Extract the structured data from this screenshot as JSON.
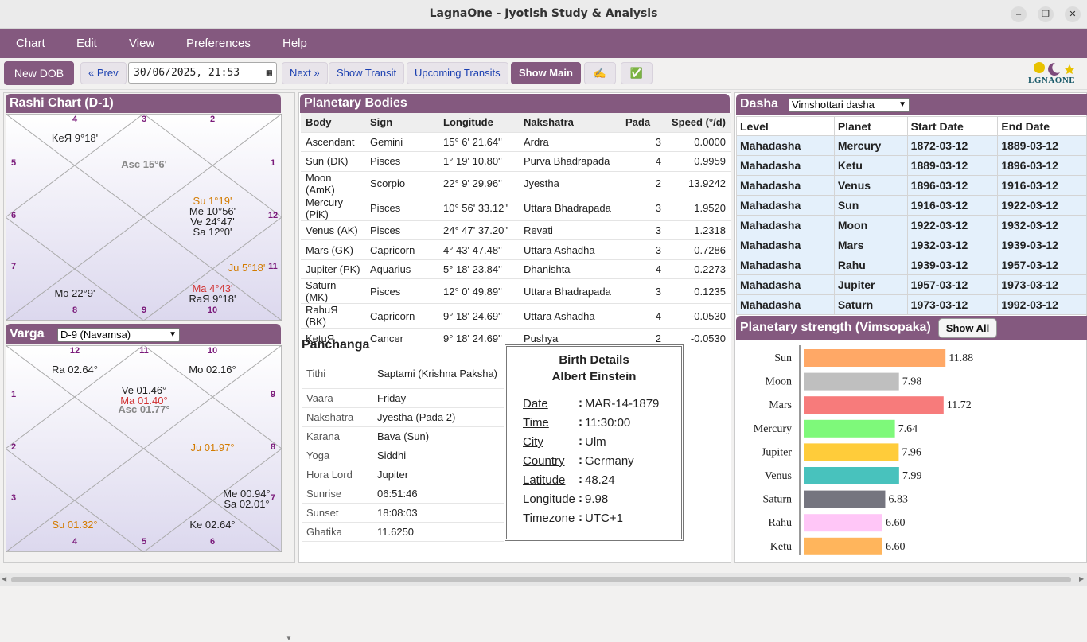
{
  "window": {
    "title": "LagnaOne - Jyotish Study & Analysis"
  },
  "menu": [
    "Chart",
    "Edit",
    "View",
    "Preferences",
    "Help"
  ],
  "toolbar": {
    "new_dob": "New DOB",
    "prev": "« Prev",
    "datetime": "30/06/2025, 21:53",
    "next": "Next »",
    "show_transit": "Show Transit",
    "upcoming_transits": "Upcoming Transits",
    "show_main": "Show Main",
    "write_icon": "✍",
    "check_icon": "✅",
    "logo_text": "LGNAONE"
  },
  "rashi": {
    "title": "Rashi Chart (D-1)",
    "signs": [
      "4",
      "3",
      "2",
      "5",
      "1",
      "6",
      "12",
      "7",
      "11",
      "8",
      "9",
      "10"
    ],
    "planets": {
      "top_left": "KeЯ 9°18'",
      "center_top": "Asc 15°6'",
      "right_mid": [
        "Su 1°19'",
        "Me 10°56'",
        "Ve 24°47'",
        "Sa 12°0'"
      ],
      "right_low": "Ju 5°18'",
      "bottom_left": "Mo 22°9'",
      "bottom_right": [
        "Ma 4°43'",
        "RaЯ 9°18'"
      ]
    }
  },
  "varga": {
    "title": "Varga",
    "selected": "D-9 (Navamsa)",
    "signs": [
      "12",
      "11",
      "10",
      "1",
      "9",
      "2",
      "8",
      "3",
      "7",
      "4",
      "5",
      "6"
    ],
    "planets": {
      "top_left": "Ra 02.64°",
      "top_right": "Mo 02.16°",
      "center": [
        "Ve 01.46°",
        "Ma 01.40°",
        "Asc 01.77°"
      ],
      "right_mid": "Ju 01.97°",
      "bottom_right_up": [
        "Me 00.94°",
        "Sa 02.01°"
      ],
      "bottom_left": "Su 01.32°",
      "bottom_center_right": "Ke 02.64°"
    }
  },
  "planetary": {
    "title": "Planetary Bodies",
    "headers": [
      "Body",
      "Sign",
      "Longitude",
      "Nakshatra",
      "Pada",
      "Speed (°/d)"
    ],
    "rows": [
      [
        "Ascendant",
        "Gemini",
        "15° 6' 21.64\"",
        "Ardra",
        "3",
        "0.0000"
      ],
      [
        "Sun (DK)",
        "Pisces",
        "1° 19' 10.80\"",
        "Purva Bhadrapada",
        "4",
        "0.9959"
      ],
      [
        "Moon (AmK)",
        "Scorpio",
        "22° 9' 29.96\"",
        "Jyestha",
        "2",
        "13.9242"
      ],
      [
        "Mercury (PiK)",
        "Pisces",
        "10° 56' 33.12\"",
        "Uttara Bhadrapada",
        "3",
        "1.9520"
      ],
      [
        "Venus (AK)",
        "Pisces",
        "24° 47' 37.20\"",
        "Revati",
        "3",
        "1.2318"
      ],
      [
        "Mars (GK)",
        "Capricorn",
        "4° 43' 47.48\"",
        "Uttara Ashadha",
        "3",
        "0.7286"
      ],
      [
        "Jupiter (PK)",
        "Aquarius",
        "5° 18' 23.84\"",
        "Dhanishta",
        "4",
        "0.2273"
      ],
      [
        "Saturn (MK)",
        "Pisces",
        "12° 0' 49.89\"",
        "Uttara Bhadrapada",
        "3",
        "0.1235"
      ],
      [
        "RahuЯ (BK)",
        "Capricorn",
        "9° 18' 24.69\"",
        "Uttara Ashadha",
        "4",
        "-0.0530"
      ],
      [
        "KetuЯ",
        "Cancer",
        "9° 18' 24.69\"",
        "Pushya",
        "2",
        "-0.0530"
      ]
    ]
  },
  "panchanga": {
    "title": "Panchanga",
    "rows": [
      [
        "Tithi",
        "Saptami (Krishna Paksha)"
      ],
      [
        "Vaara",
        "Friday"
      ],
      [
        "Nakshatra",
        "Jyestha (Pada 2)"
      ],
      [
        "Karana",
        "Bava (Sun)"
      ],
      [
        "Yoga",
        "Siddhi"
      ],
      [
        "Hora Lord",
        "Jupiter"
      ],
      [
        "Sunrise",
        "06:51:46"
      ],
      [
        "Sunset",
        "18:08:03"
      ],
      [
        "Ghatika",
        "11.6250"
      ]
    ]
  },
  "birth": {
    "title": "Birth Details",
    "name": "Albert Einstein",
    "fields": [
      [
        "Date",
        "MAR-14-1879"
      ],
      [
        "Time",
        "11:30:00"
      ],
      [
        "City",
        "Ulm"
      ],
      [
        "Country",
        "Germany"
      ],
      [
        "Latitude",
        "48.24"
      ],
      [
        "Longitude",
        "9.98"
      ],
      [
        "Timezone",
        "UTC+1"
      ]
    ]
  },
  "dasha": {
    "title": "Dasha",
    "selected": "Vimshottari dasha",
    "headers": [
      "Level",
      "Planet",
      "Start Date",
      "End Date"
    ],
    "rows": [
      [
        "Mahadasha",
        "Mercury",
        "1872-03-12",
        "1889-03-12"
      ],
      [
        "Mahadasha",
        "Ketu",
        "1889-03-12",
        "1896-03-12"
      ],
      [
        "Mahadasha",
        "Venus",
        "1896-03-12",
        "1916-03-12"
      ],
      [
        "Mahadasha",
        "Sun",
        "1916-03-12",
        "1922-03-12"
      ],
      [
        "Mahadasha",
        "Moon",
        "1922-03-12",
        "1932-03-12"
      ],
      [
        "Mahadasha",
        "Mars",
        "1932-03-12",
        "1939-03-12"
      ],
      [
        "Mahadasha",
        "Rahu",
        "1939-03-12",
        "1957-03-12"
      ],
      [
        "Mahadasha",
        "Jupiter",
        "1957-03-12",
        "1973-03-12"
      ],
      [
        "Mahadasha",
        "Saturn",
        "1973-03-12",
        "1992-03-12"
      ]
    ]
  },
  "strength": {
    "title": "Planetary strength (Vimsopaka)",
    "show_all": "Show All"
  },
  "chart_data": {
    "type": "bar",
    "orientation": "horizontal",
    "categories": [
      "Sun",
      "Moon",
      "Mars",
      "Mercury",
      "Jupiter",
      "Venus",
      "Saturn",
      "Rahu",
      "Ketu"
    ],
    "values": [
      11.88,
      7.98,
      11.72,
      7.64,
      7.96,
      7.99,
      6.83,
      6.6,
      6.6
    ],
    "colors": [
      "#ffa866",
      "#bfbfbf",
      "#f77b7b",
      "#7ef97a",
      "#ffcc3a",
      "#48c2bd",
      "#75757f",
      "#ffc6f7",
      "#ffb55c"
    ],
    "xlim": [
      0,
      20
    ]
  }
}
